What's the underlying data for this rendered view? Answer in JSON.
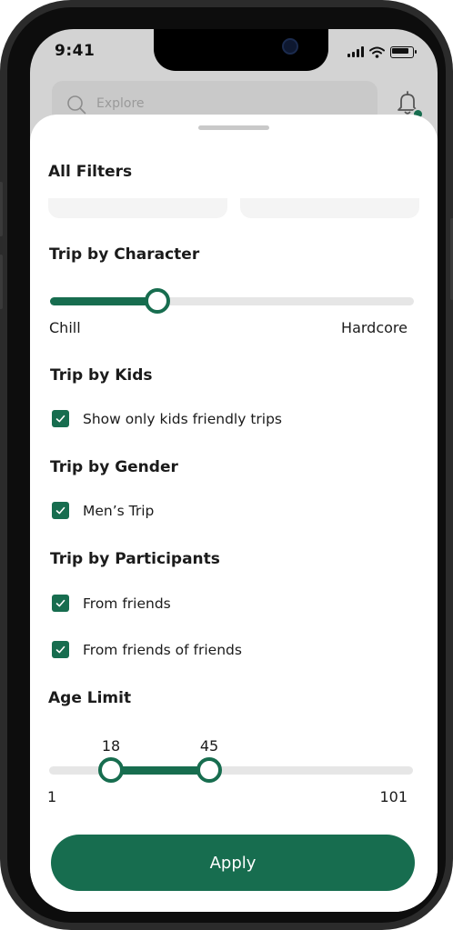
{
  "status_bar": {
    "time": "9:41"
  },
  "search": {
    "placeholder": "Explore"
  },
  "sheet": {
    "title": "All Filters"
  },
  "character": {
    "title": "Trip by Character",
    "min_label": "Chill",
    "max_label": "Hardcore",
    "value_fraction": 0.295
  },
  "kids": {
    "title": "Trip by Kids",
    "options": [
      {
        "label": "Show only kids friendly trips",
        "checked": true
      }
    ]
  },
  "gender": {
    "title": "Trip by Gender",
    "options": [
      {
        "label": "Men’s Trip",
        "checked": true
      }
    ]
  },
  "participants": {
    "title": "Trip by Participants",
    "options": [
      {
        "label": "From friends",
        "checked": true
      },
      {
        "label": "From friends of friends",
        "checked": true
      }
    ]
  },
  "age": {
    "title": "Age Limit",
    "min": 1,
    "max": 101,
    "min_label": "1",
    "max_label": "101",
    "low": 18,
    "high": 45,
    "low_label": "18",
    "high_label": "45"
  },
  "apply_label": "Apply",
  "colors": {
    "accent": "#176d4f",
    "track": "#e6e6e6",
    "backdrop": "#d3d3d3"
  }
}
